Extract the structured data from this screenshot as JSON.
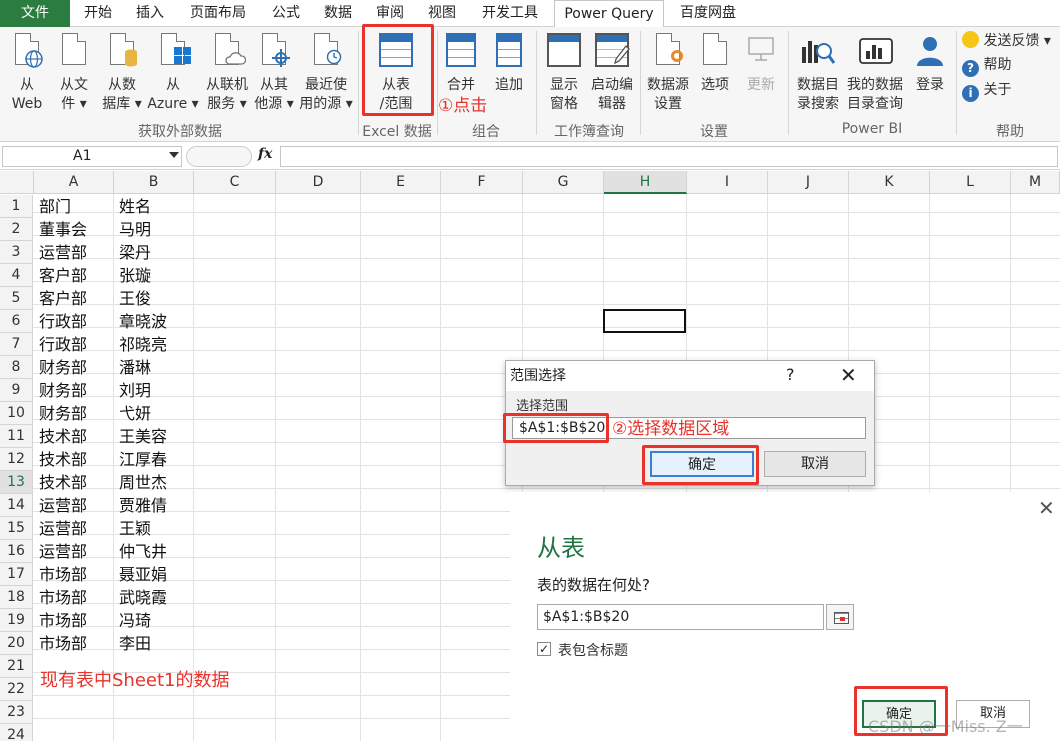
{
  "tabs": [
    "文件",
    "开始",
    "插入",
    "页面布局",
    "公式",
    "数据",
    "审阅",
    "视图",
    "开发工具",
    "Power Query",
    "百度网盘"
  ],
  "ribbon": {
    "get_external": {
      "label": "获取外部数据",
      "buttons": [
        {
          "l1": "从",
          "l2": "Web"
        },
        {
          "l1": "从文",
          "l2": "件 ▾"
        },
        {
          "l1": "从数",
          "l2": "据库 ▾"
        },
        {
          "l1": "从",
          "l2": "Azure ▾"
        },
        {
          "l1": "从联机",
          "l2": "服务 ▾"
        },
        {
          "l1": "从其",
          "l2": "他源 ▾"
        },
        {
          "l1": "最近使",
          "l2": "用的源 ▾"
        }
      ]
    },
    "excel_data": {
      "label": "Excel 数据",
      "from_table": {
        "l1": "从表",
        "l2": "/范围"
      }
    },
    "combine": {
      "label": "组合",
      "merge": "合并",
      "append": "追加"
    },
    "workbook_query": {
      "label": "工作簿查询",
      "show": {
        "l1": "显示",
        "l2": "窗格"
      },
      "launch": {
        "l1": "启动编",
        "l2": "辑器"
      }
    },
    "settings": {
      "label": "设置",
      "datasource": {
        "l1": "数据源",
        "l2": "设置"
      },
      "options": "选项",
      "update": "更新"
    },
    "powerbi": {
      "label": "Power BI",
      "catalog": {
        "l1": "数据目",
        "l2": "录搜索"
      },
      "myqueries": {
        "l1": "我的数据",
        "l2": "目录查询"
      },
      "login": "登录"
    },
    "help": {
      "label": "帮助",
      "feedback": "发送反馈 ▾",
      "help": "帮助",
      "about": "关于"
    }
  },
  "annotations": {
    "step1": "①点击",
    "step2": "②选择数据区域",
    "sheet_note": "现有表中Sheet1的数据"
  },
  "formula_bar": {
    "name_box": "A1",
    "fx": "fx"
  },
  "columns": [
    "A",
    "B",
    "C",
    "D",
    "E",
    "F",
    "G",
    "H",
    "I",
    "J",
    "K",
    "L",
    "M"
  ],
  "rows": [
    [
      "部门",
      "姓名"
    ],
    [
      "董事会",
      "马明"
    ],
    [
      "运营部",
      "梁丹"
    ],
    [
      "客户部",
      "张璇"
    ],
    [
      "客户部",
      "王俊"
    ],
    [
      "行政部",
      "章晓波"
    ],
    [
      "行政部",
      "祁晓亮"
    ],
    [
      "财务部",
      "潘琳"
    ],
    [
      "财务部",
      "刘玥"
    ],
    [
      "财务部",
      "弋妍"
    ],
    [
      "技术部",
      "王美容"
    ],
    [
      "技术部",
      "江厚春"
    ],
    [
      "技术部",
      "周世杰"
    ],
    [
      "运营部",
      "贾雅倩"
    ],
    [
      "运营部",
      "王颖"
    ],
    [
      "运营部",
      "仲飞井"
    ],
    [
      "市场部",
      "聂亚娟"
    ],
    [
      "市场部",
      "武晓霞"
    ],
    [
      "市场部",
      "冯琦"
    ],
    [
      "市场部",
      "李田"
    ],
    [
      "",
      ""
    ],
    [
      "",
      ""
    ],
    [
      "",
      ""
    ],
    [
      "",
      ""
    ]
  ],
  "range_dialog": {
    "title": "范围选择",
    "help": "?",
    "close": "✕",
    "label": "选择范围",
    "value": "$A$1:$B$20",
    "ok": "确定",
    "cancel": "取消"
  },
  "from_table_dialog": {
    "close": "✕",
    "title": "从表",
    "question": "表的数据在何处?",
    "value": "$A$1:$B$20",
    "checkbox_checked": "✓",
    "checkbox_label": "表包含标题",
    "ok": "确定",
    "cancel": "取消"
  },
  "watermark": "CSDN @一Miss. Z一",
  "colors": {
    "accent": "#217346",
    "highlight": "#e8322a",
    "file_tab": "#2b7d3f"
  }
}
